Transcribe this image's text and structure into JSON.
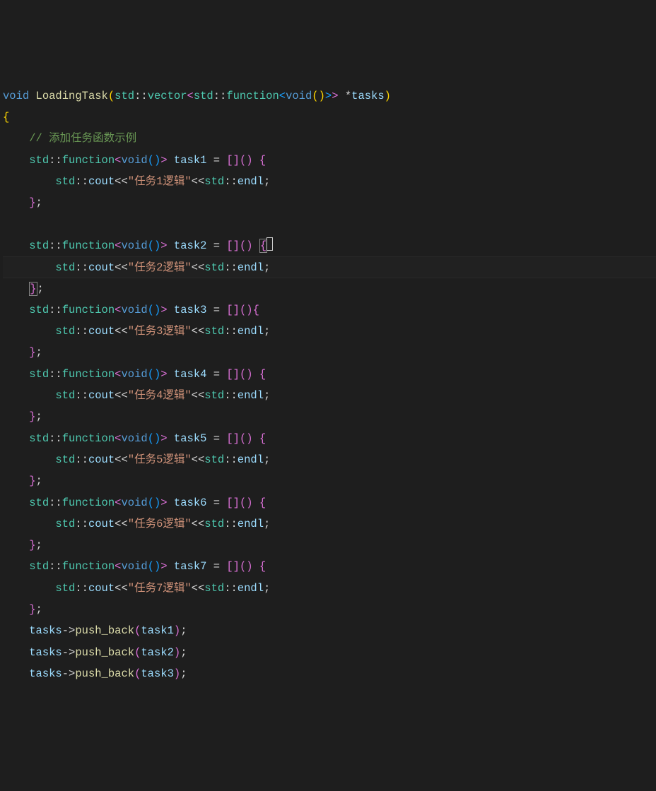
{
  "code": {
    "fn_sig": {
      "ret": "void",
      "name": "LoadingTask",
      "param_type_open": "std",
      "vector": "vector",
      "function": "function",
      "void_inner": "void",
      "param_name": "tasks"
    },
    "comment": "// 添加任务函数示例",
    "std": "std",
    "function_kw": "function",
    "void_kw": "void",
    "cout": "cout",
    "endl": "endl",
    "push_back": "push_back",
    "tasks": {
      "t1": {
        "var": "task1",
        "str": "\"任务1逻辑\""
      },
      "t2": {
        "var": "task2",
        "str": "\"任务2逻辑\""
      },
      "t3": {
        "var": "task3",
        "str": "\"任务3逻辑\""
      },
      "t4": {
        "var": "task4",
        "str": "\"任务4逻辑\""
      },
      "t5": {
        "var": "task5",
        "str": "\"任务5逻辑\""
      },
      "t6": {
        "var": "task6",
        "str": "\"任务6逻辑\""
      },
      "t7": {
        "var": "task7",
        "str": "\"任务7逻辑\""
      }
    },
    "push_vars": {
      "p1": "task1",
      "p2": "task2",
      "p3": "task3"
    }
  }
}
